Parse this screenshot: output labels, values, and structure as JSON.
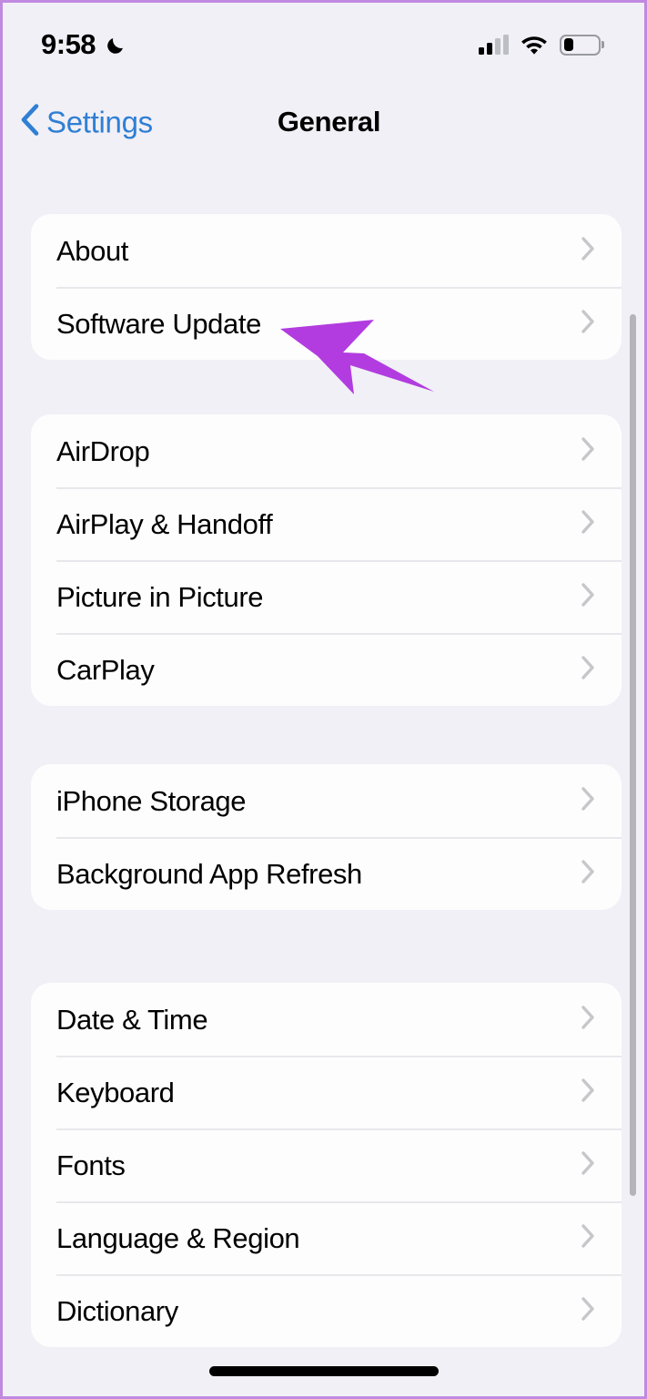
{
  "status_bar": {
    "time": "9:58",
    "focus_icon": "crescent-moon-icon",
    "signal_icon": "cellular-signal-icon",
    "signal_bars_filled": 2,
    "signal_bars_total": 4,
    "wifi_icon": "wifi-icon",
    "battery_icon": "battery-icon",
    "battery_level_percent": 30
  },
  "nav": {
    "back_label": "Settings",
    "back_icon": "chevron-left-icon",
    "title": "General"
  },
  "groups": [
    {
      "rows": [
        {
          "label": "About",
          "chevron": "chevron-right-icon"
        },
        {
          "label": "Software Update",
          "chevron": "chevron-right-icon"
        }
      ]
    },
    {
      "rows": [
        {
          "label": "AirDrop",
          "chevron": "chevron-right-icon"
        },
        {
          "label": "AirPlay & Handoff",
          "chevron": "chevron-right-icon"
        },
        {
          "label": "Picture in Picture",
          "chevron": "chevron-right-icon"
        },
        {
          "label": "CarPlay",
          "chevron": "chevron-right-icon"
        }
      ]
    },
    {
      "rows": [
        {
          "label": "iPhone Storage",
          "chevron": "chevron-right-icon"
        },
        {
          "label": "Background App Refresh",
          "chevron": "chevron-right-icon"
        }
      ]
    },
    {
      "rows": [
        {
          "label": "Date & Time",
          "chevron": "chevron-right-icon"
        },
        {
          "label": "Keyboard",
          "chevron": "chevron-right-icon"
        },
        {
          "label": "Fonts",
          "chevron": "chevron-right-icon"
        },
        {
          "label": "Language & Region",
          "chevron": "chevron-right-icon"
        },
        {
          "label": "Dictionary",
          "chevron": "chevron-right-icon"
        }
      ]
    }
  ],
  "annotation": {
    "type": "arrow-pointer",
    "points_at": "Software Update",
    "color": "#b23ce0"
  },
  "colors": {
    "accent_blue": "#2f7fd4",
    "page_background": "#F1F0F6",
    "card_background": "#FDFDFD",
    "separator": "#e8e8ec",
    "chevron_gray": "#c6c6cb",
    "frame_border": "#c08ae0",
    "annotation_purple": "#b23ce0"
  },
  "home_indicator": "home-indicator-bar"
}
